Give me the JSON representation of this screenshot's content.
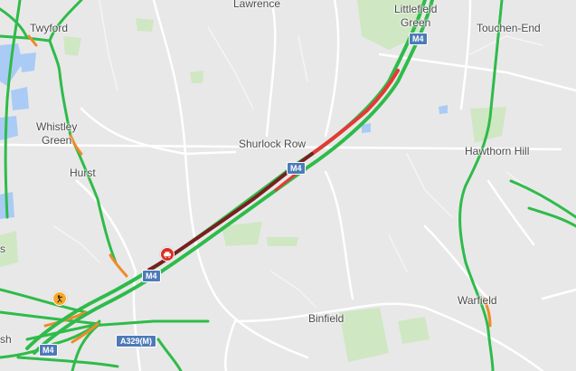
{
  "map": {
    "colors": {
      "background": "#e8e8e8",
      "park": "#cfe7c3",
      "water": "#aacbf5",
      "traffic_free": "#2fbb4a",
      "traffic_slow": "#f08a2a",
      "traffic_heavy": "#e53935",
      "traffic_jam": "#7a1f1f",
      "road_shield": "#4e7ab8",
      "incident_marker": "#d93025",
      "roadworks_marker": "#f9a825"
    },
    "places": {
      "twyford": "Twyford",
      "lawrence": "Lawrence",
      "littlefield_green": "Littlefield\nGreen",
      "touchen_end": "Touchen-End",
      "whistley_green": "Whistley\nGreen",
      "hurst": "Hurst",
      "shurlock_row": "Shurlock Row",
      "hawthorn_hill": "Hawthorn Hill",
      "warfield": "Warfield",
      "binfield": "Binfield",
      "edge_sh": "sh",
      "edge_s": "s"
    },
    "road_labels": {
      "m4_top": "M4",
      "m4_mid": "M4",
      "m4_lower": "M4",
      "m4_bottom": "M4",
      "a329m": "A329(M)"
    },
    "markers": {
      "incident": "car-crash-icon",
      "roadworks": "roadworks-icon"
    }
  }
}
